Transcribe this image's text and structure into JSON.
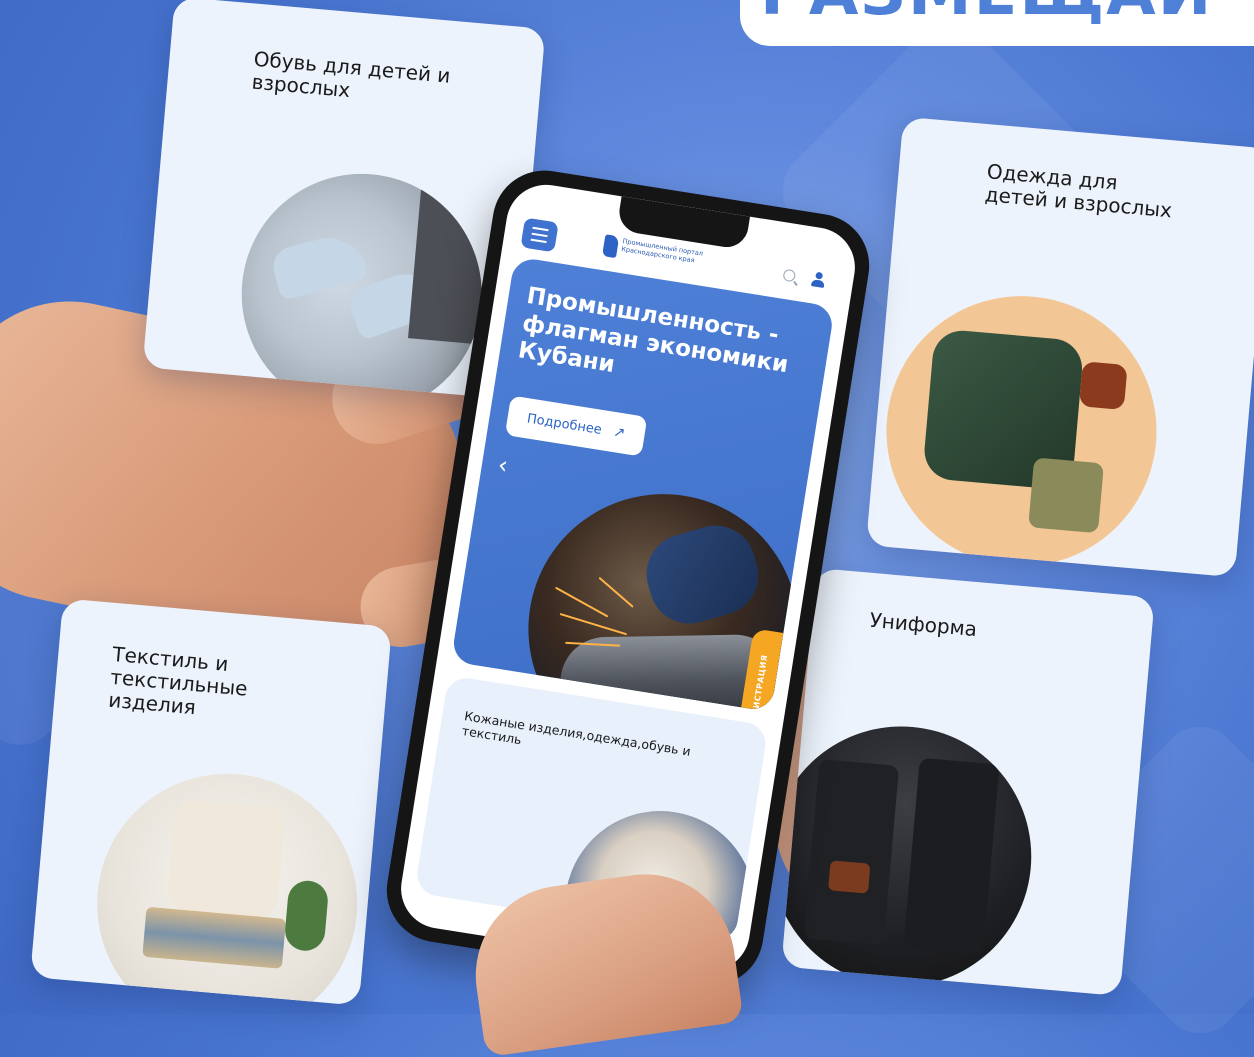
{
  "headline": "РАЗМЕЩАЙ",
  "cards": {
    "shoes": {
      "title": "Обувь для детей и взрослых"
    },
    "clothing": {
      "title": "Одежда для детей и взрослых"
    },
    "textile": {
      "title": "Текстиль и текстильные изделия"
    },
    "uniform": {
      "title": "Униформа"
    }
  },
  "phone": {
    "portal_name": "Промышленный портал Краснодарского края",
    "hero_title": "Промышленность - флагман экономики Кубани",
    "more_button": "Подробнее",
    "more_arrow": "↗",
    "prev_chevron": "‹",
    "next_chevron": "›",
    "registration_tab": "РЕГИСТРАЦИЯ",
    "category_title": "Кожаные изделия,одежда,обувь и текстиль"
  },
  "icons": {
    "menu": "hamburger-menu-icon",
    "search": "search-icon",
    "user": "user-icon",
    "logo": "krasnodar-region-logo-icon"
  },
  "colors": {
    "background": "#5f88dd",
    "accent_blue": "#3f73cf",
    "registration_orange": "#f5a623",
    "card_bg": "#edf3fc"
  }
}
